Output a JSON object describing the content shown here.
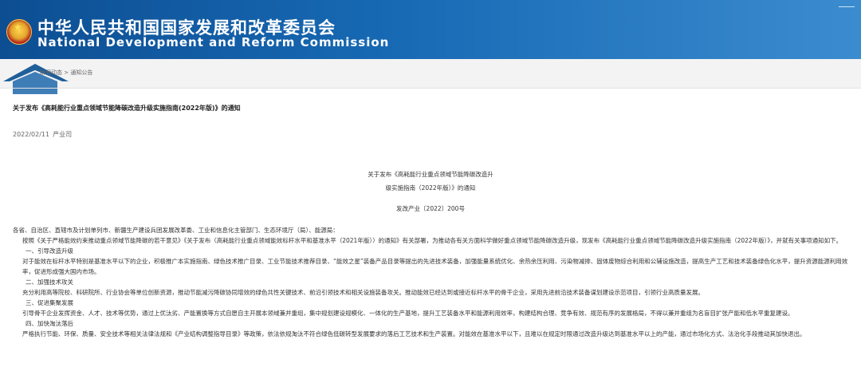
{
  "header": {
    "title_cn": "中华人民共和国国家发展和改革委员会",
    "title_en": "National Development and Reform Commission"
  },
  "breadcrumb": {
    "text": "新闻动态 > 通知公告"
  },
  "article": {
    "title": "关于发布《高耗能行业重点领域节能降碳改造升级实施指南(2022年版)》的通知",
    "date": "2022/02/11",
    "department": "产业司",
    "doc_title_line1": "关于发布《高耗能行业重点领域节能降碳改造升",
    "doc_title_line2": "级实施指南（2022年版）》的通知",
    "doc_number": "发改产业〔2022〕200号",
    "addressee": "各省、自治区、直辖市及计划单列市、新疆生产建设兵团发展改革委、工业和信息化主管部门、生态环境厅（局）、能源局：",
    "para1": "按照《关于严格能效约束推动重点领域节能降碳的若干意见》《关于发布〈高耗能行业重点领域能效标杆水平和基准水平（2021年版）〉的通知》有关部署，为推动各有关方面科学做好重点领域节能降碳改造升级，现发布《高耗能行业重点领域节能降碳改造升级实施指南（2022年版）》，并就有关事项通知如下。",
    "s1_heading": "一、引导改造升级",
    "s1_text": "对于能效在标杆水平特别是基准水平以下的企业，积极推广本实施指南、绿色技术推广目录、工业节能技术推荐目录、“能效之星”装备产品目录等提出的先进技术装备，加强能量系统优化、余热余压利用、污染物减排、固体废物综合利用和公辅设施改造，提高生产工艺和技术装备绿色化水平，提升资源能源利用效率，促进形成强大国内市场。",
    "s2_heading": "二、加强技术攻关",
    "s2_text": "充分利用高等院校、科研院所、行业协会等单位创新资源，推动节能减污降碳协同增效的绿色共性关键技术、前沿引领技术和相关设施装备攻关。推动能效已经达到或接近标杆水平的骨干企业，采用先进前沿技术装备谋划建设示范项目，引领行业高质量发展。",
    "s3_heading": "三、促进集聚发展",
    "s3_text": "引导骨干企业发挥资金、人才、技术等优势，通过上优汰劣、产能置换等方式自愿自主开展本领域兼并重组，集中规划建设规模化、一体化的生产基地，提升工艺装备水平和能源利用效率，构建结构合理、竞争有效、规范有序的发展格局，不得以兼并重组为名盲目扩张产能和低水平重复建设。",
    "s4_heading": "四、加快淘汰落后",
    "s4_text": "严格执行节能、环保、质量、安全技术等相关法律法规和《产业结构调整指导目录》等政策，依法依规淘汰不符合绿色低碳转型发展要求的落后工艺技术和生产装置。对能效在基准水平以下，且难以在规定时限通过改造升级达到基准水平以上的产能，通过市场化方式、法治化手段推动其加快退出。"
  }
}
